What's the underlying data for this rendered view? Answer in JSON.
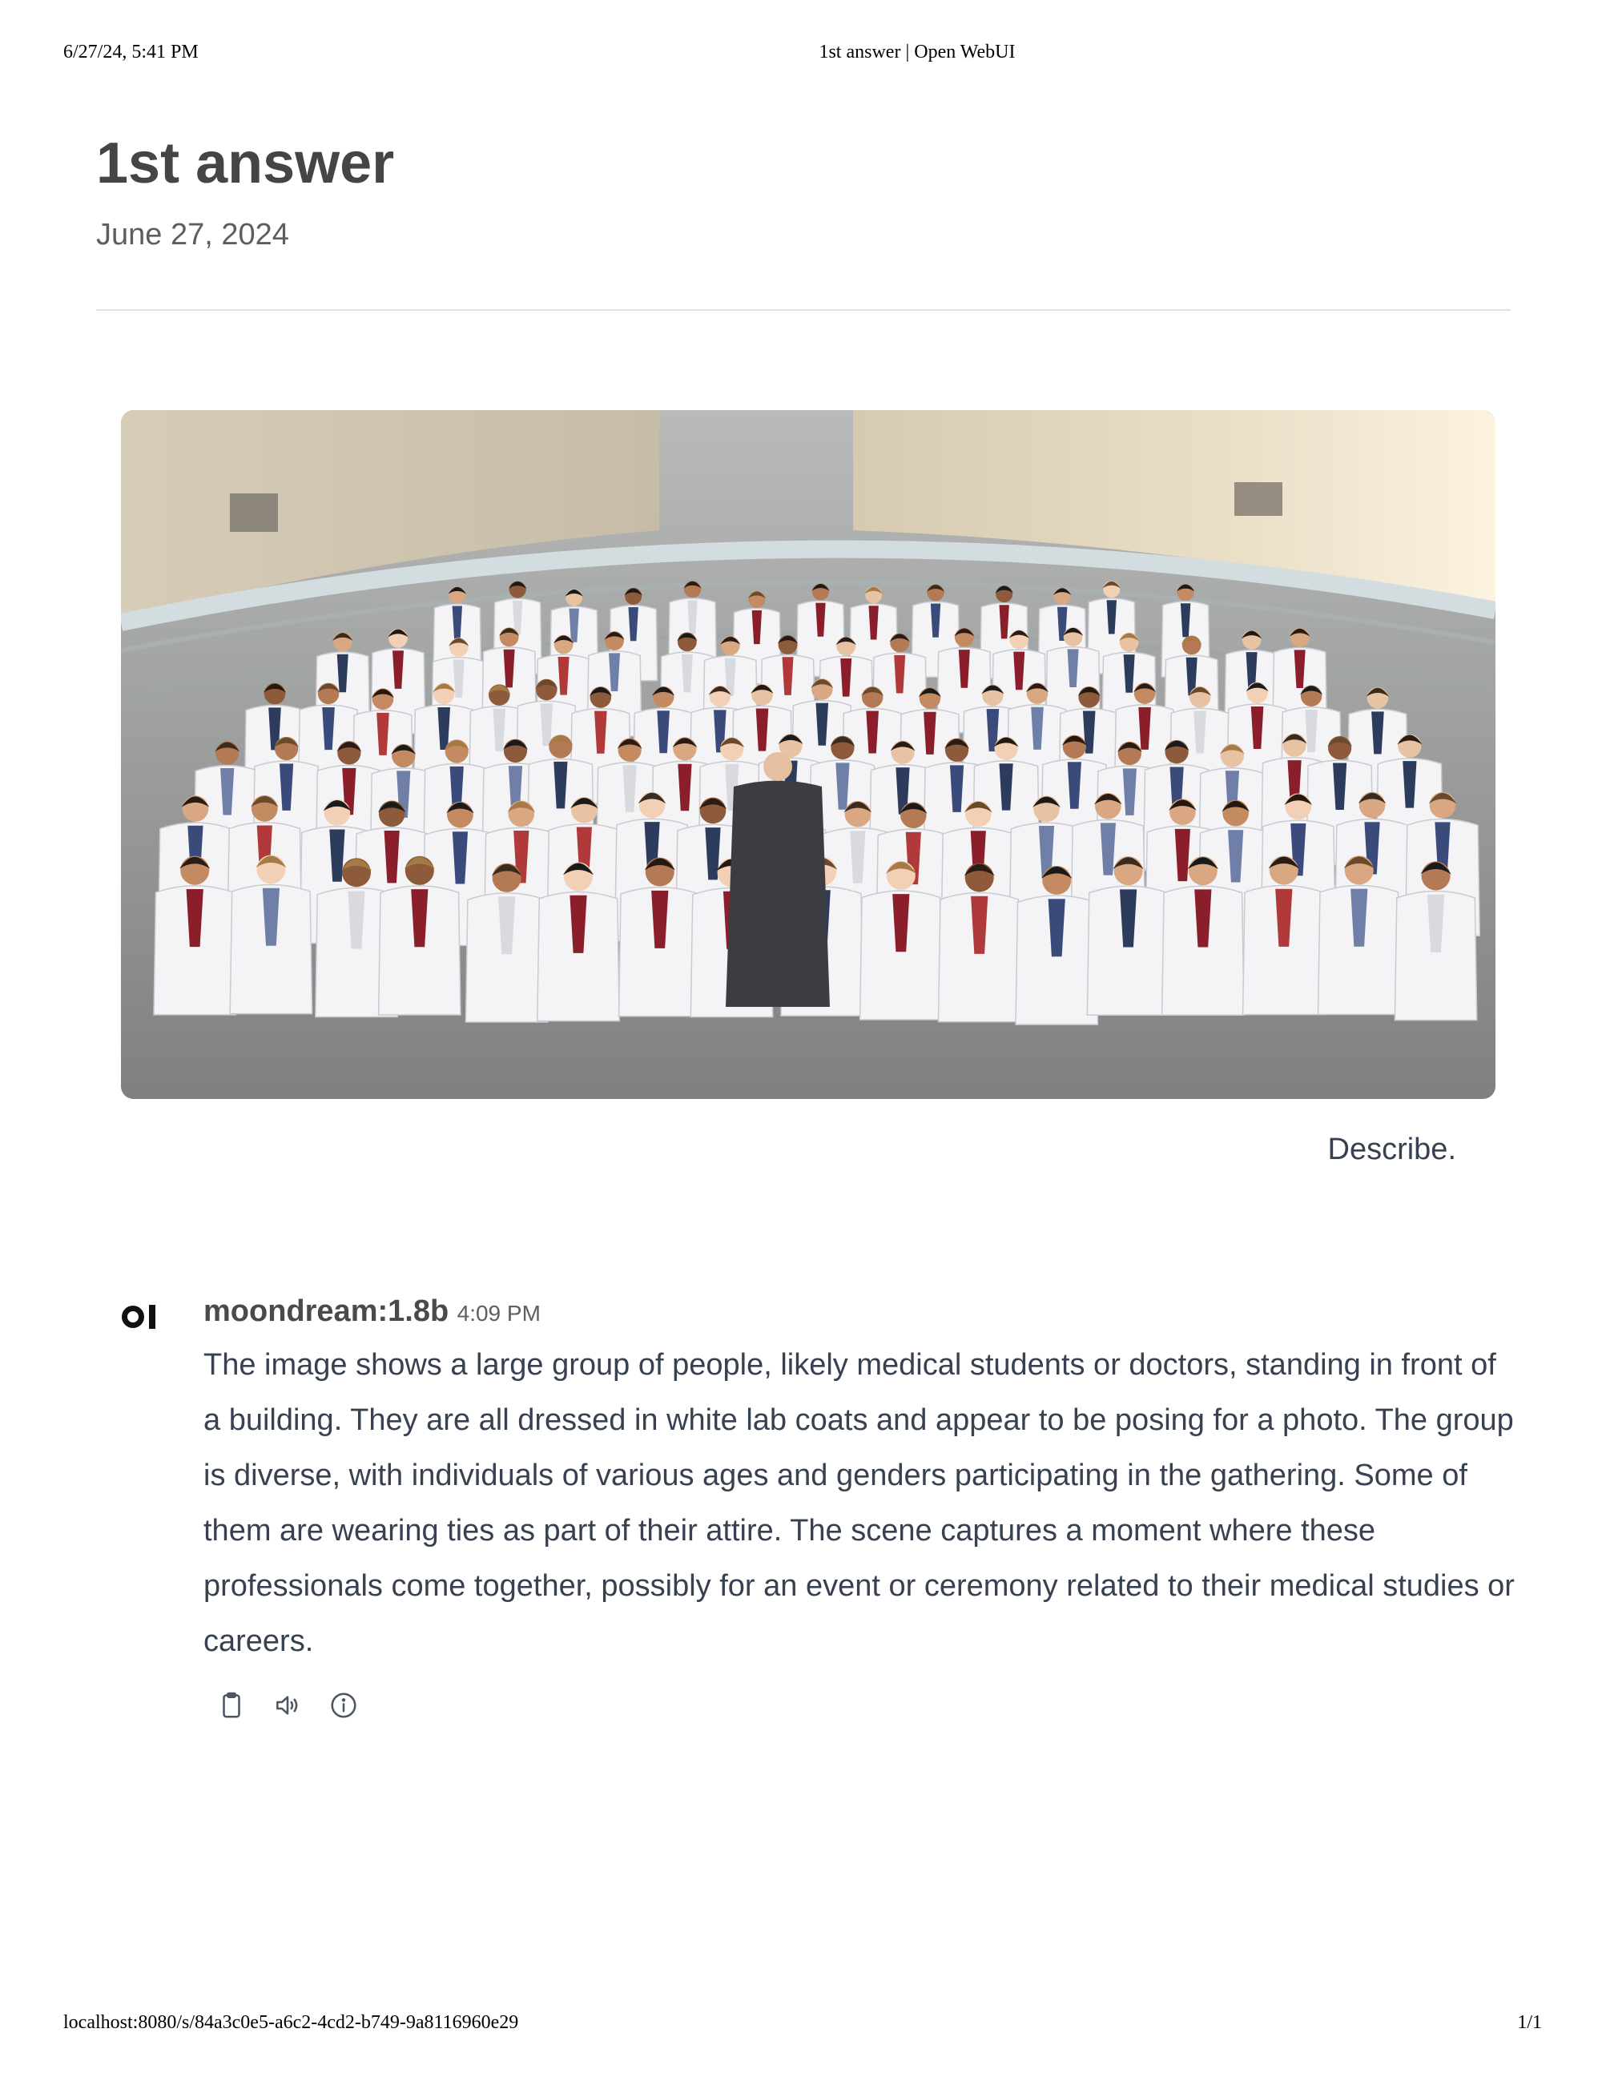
{
  "print_header": {
    "datetime": "6/27/24, 5:41 PM",
    "page_title": "1st answer | Open WebUI"
  },
  "chat": {
    "title": "1st answer",
    "date": "June 27, 2024"
  },
  "user_message": {
    "image": "group-photo",
    "text": "Describe."
  },
  "assistant_message": {
    "avatar": "OI",
    "model": "moondream:1.8b",
    "time": "4:09 PM",
    "text": "The image shows a large group of people, likely medical students or doctors, standing in front of a building. They are all dressed in white lab coats and appear to be posing for a photo. The group is diverse, with individuals of various ages and genders participating in the gathering. Some of them are wearing ties as part of their attire. The scene captures a moment where these professionals come together, possibly for an event or ceremony related to their medical studies or careers.",
    "actions": [
      {
        "name": "copy",
        "icon": "clipboard-icon"
      },
      {
        "name": "read-aloud",
        "icon": "speaker-icon"
      },
      {
        "name": "generation-info",
        "icon": "info-icon"
      }
    ]
  },
  "print_footer": {
    "url": "localhost:8080/s/84a3c0e5-a6c2-4cd2-b749-9a8116960e29",
    "page_number": "1/1"
  }
}
